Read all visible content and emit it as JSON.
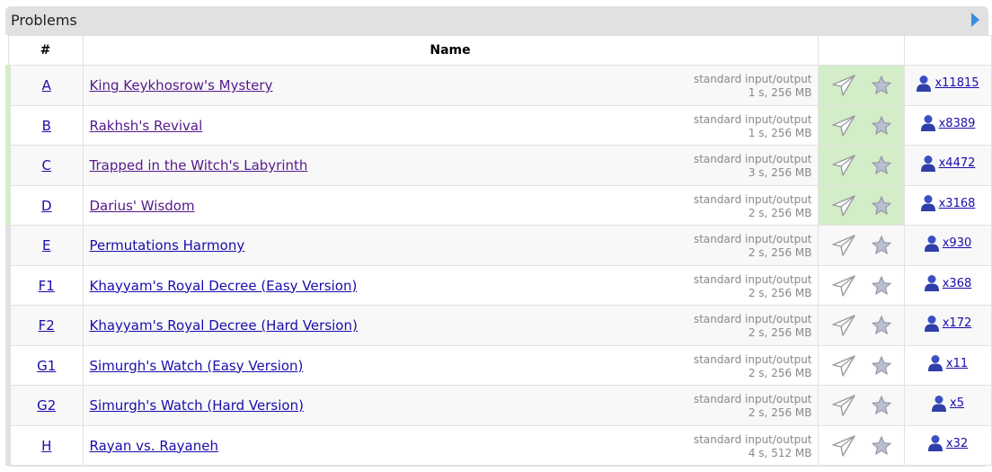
{
  "panel": {
    "title": "Problems",
    "collapse_icon": "triangle-right-icon"
  },
  "table": {
    "headers": {
      "index": "#",
      "name": "Name"
    },
    "rows": [
      {
        "index": "A",
        "name": "King Keykhosrow's Mystery",
        "io": "standard input/output",
        "limits": "1 s, 256 MB",
        "solved": "x11815",
        "accepted": true,
        "visited": true
      },
      {
        "index": "B",
        "name": "Rakhsh's Revival",
        "io": "standard input/output",
        "limits": "1 s, 256 MB",
        "solved": "x8389",
        "accepted": true,
        "visited": true
      },
      {
        "index": "C",
        "name": "Trapped in the Witch's Labyrinth",
        "io": "standard input/output",
        "limits": "3 s, 256 MB",
        "solved": "x4472",
        "accepted": true,
        "visited": true
      },
      {
        "index": "D",
        "name": "Darius' Wisdom",
        "io": "standard input/output",
        "limits": "2 s, 256 MB",
        "solved": "x3168",
        "accepted": true,
        "visited": true
      },
      {
        "index": "E",
        "name": "Permutations Harmony",
        "io": "standard input/output",
        "limits": "2 s, 256 MB",
        "solved": "x930",
        "accepted": false,
        "visited": false
      },
      {
        "index": "F1",
        "name": "Khayyam's Royal Decree (Easy Version)",
        "io": "standard input/output",
        "limits": "2 s, 256 MB",
        "solved": "x368",
        "accepted": false,
        "visited": false
      },
      {
        "index": "F2",
        "name": "Khayyam's Royal Decree (Hard Version)",
        "io": "standard input/output",
        "limits": "2 s, 256 MB",
        "solved": "x172",
        "accepted": false,
        "visited": false
      },
      {
        "index": "G1",
        "name": "Simurgh's Watch (Easy Version)",
        "io": "standard input/output",
        "limits": "2 s, 256 MB",
        "solved": "x11",
        "accepted": false,
        "visited": false
      },
      {
        "index": "G2",
        "name": "Simurgh's Watch (Hard Version)",
        "io": "standard input/output",
        "limits": "2 s, 256 MB",
        "solved": "x5",
        "accepted": false,
        "visited": false
      },
      {
        "index": "H",
        "name": "Rayan vs. Rayaneh",
        "io": "standard input/output",
        "limits": "4 s, 512 MB",
        "solved": "x32",
        "accepted": false,
        "visited": false
      }
    ],
    "row_icons": {
      "submit": "paper-plane-icon",
      "favorite": "star-icon",
      "solvers": "user-icon"
    }
  },
  "colors": {
    "accepted_bg": "#d4edc9",
    "panel_bg": "#e1e1e1",
    "link": "#1a0dab",
    "visited_link": "#551a8b"
  }
}
